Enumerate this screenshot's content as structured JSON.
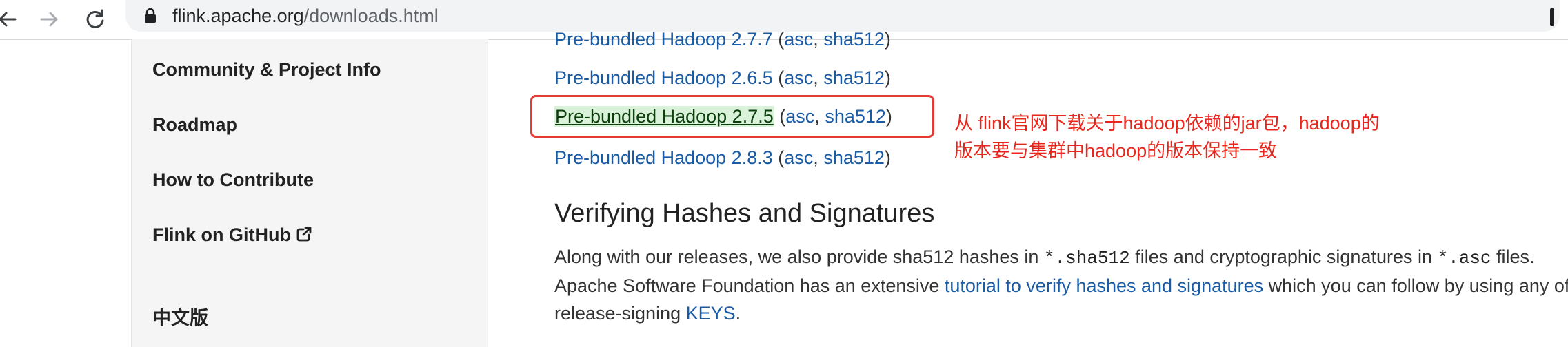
{
  "browser": {
    "url_host": "flink.apache.org",
    "url_path": "/downloads.html"
  },
  "sidebar": {
    "items": [
      {
        "label": "Community & Project Info"
      },
      {
        "label": "Roadmap"
      },
      {
        "label": "How to Contribute"
      },
      {
        "label": "Flink on GitHub"
      },
      {
        "label": "中文版"
      }
    ]
  },
  "downloads": {
    "lines": [
      {
        "name": "Pre-bundled Hadoop 2.7.7",
        "asc": "asc",
        "sha": "sha512"
      },
      {
        "name": "Pre-bundled Hadoop 2.6.5",
        "asc": "asc",
        "sha": "sha512"
      },
      {
        "name": "Pre-bundled Hadoop 2.7.5",
        "asc": "asc",
        "sha": "sha512"
      },
      {
        "name": "Pre-bundled Hadoop 2.8.3",
        "asc": "asc",
        "sha": "sha512"
      }
    ],
    "punct_open": "(",
    "punct_comma": ", ",
    "punct_close": ")"
  },
  "annotation": {
    "line1": "从 flink官网下载关于hadoop依赖的jar包，hadoop的",
    "line2": "版本要与集群中hadoop的版本保持一致",
    "color": "#e8261c"
  },
  "section": {
    "heading": "Verifying Hashes and Signatures",
    "p1_a": "Along with our releases, we also provide sha512 hashes in ",
    "p1_code1": "*.sha512",
    "p1_b": " files and cryptographic signatures in ",
    "p1_code2": "*.asc",
    "p1_c": " files.",
    "p2_a": "Apache Software Foundation has an extensive ",
    "p2_link": "tutorial to verify hashes and signatures",
    "p2_b": " which you can follow by using any of these",
    "p3_a": "release-signing ",
    "p3_link": "KEYS",
    "p3_b": "."
  },
  "colors": {
    "link": "#1a5ba6",
    "highlight_bg": "#d9f2d9",
    "box_border": "#e53935"
  }
}
